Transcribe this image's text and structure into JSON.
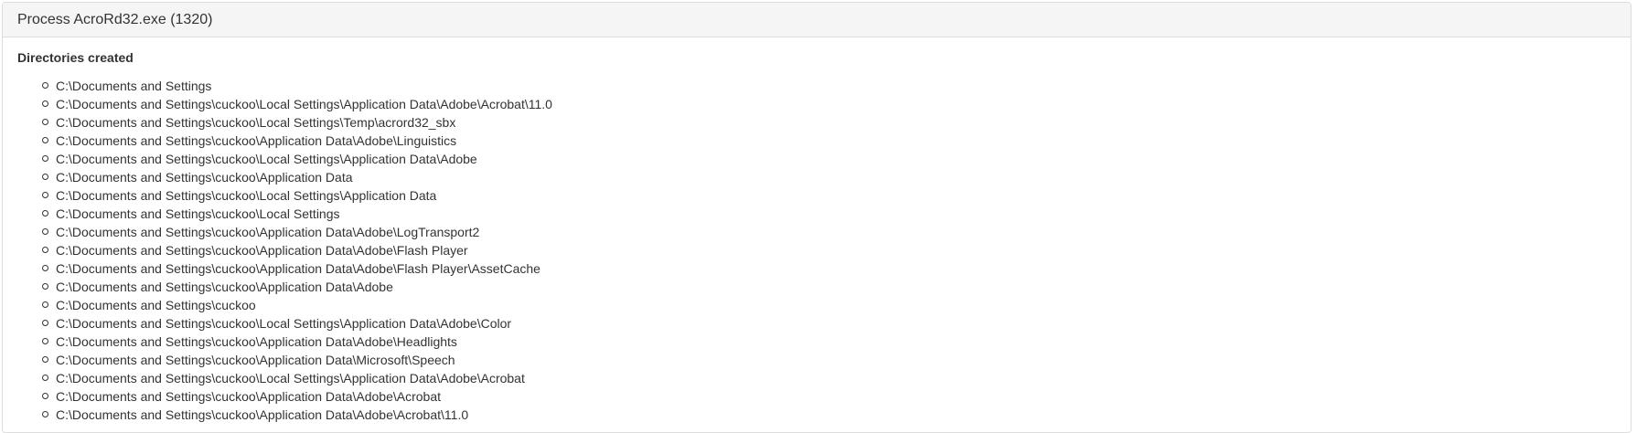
{
  "panel": {
    "title": "Process AcroRd32.exe (1320)"
  },
  "section": {
    "title": "Directories created",
    "items": [
      "C:\\Documents and Settings",
      "C:\\Documents and Settings\\cuckoo\\Local Settings\\Application Data\\Adobe\\Acrobat\\11.0",
      "C:\\Documents and Settings\\cuckoo\\Local Settings\\Temp\\acrord32_sbx",
      "C:\\Documents and Settings\\cuckoo\\Application Data\\Adobe\\Linguistics",
      "C:\\Documents and Settings\\cuckoo\\Local Settings\\Application Data\\Adobe",
      "C:\\Documents and Settings\\cuckoo\\Application Data",
      "C:\\Documents and Settings\\cuckoo\\Local Settings\\Application Data",
      "C:\\Documents and Settings\\cuckoo\\Local Settings",
      "C:\\Documents and Settings\\cuckoo\\Application Data\\Adobe\\LogTransport2",
      "C:\\Documents and Settings\\cuckoo\\Application Data\\Adobe\\Flash Player",
      "C:\\Documents and Settings\\cuckoo\\Application Data\\Adobe\\Flash Player\\AssetCache",
      "C:\\Documents and Settings\\cuckoo\\Application Data\\Adobe",
      "C:\\Documents and Settings\\cuckoo",
      "C:\\Documents and Settings\\cuckoo\\Local Settings\\Application Data\\Adobe\\Color",
      "C:\\Documents and Settings\\cuckoo\\Application Data\\Adobe\\Headlights",
      "C:\\Documents and Settings\\cuckoo\\Application Data\\Microsoft\\Speech",
      "C:\\Documents and Settings\\cuckoo\\Local Settings\\Application Data\\Adobe\\Acrobat",
      "C:\\Documents and Settings\\cuckoo\\Application Data\\Adobe\\Acrobat",
      "C:\\Documents and Settings\\cuckoo\\Application Data\\Adobe\\Acrobat\\11.0"
    ]
  }
}
